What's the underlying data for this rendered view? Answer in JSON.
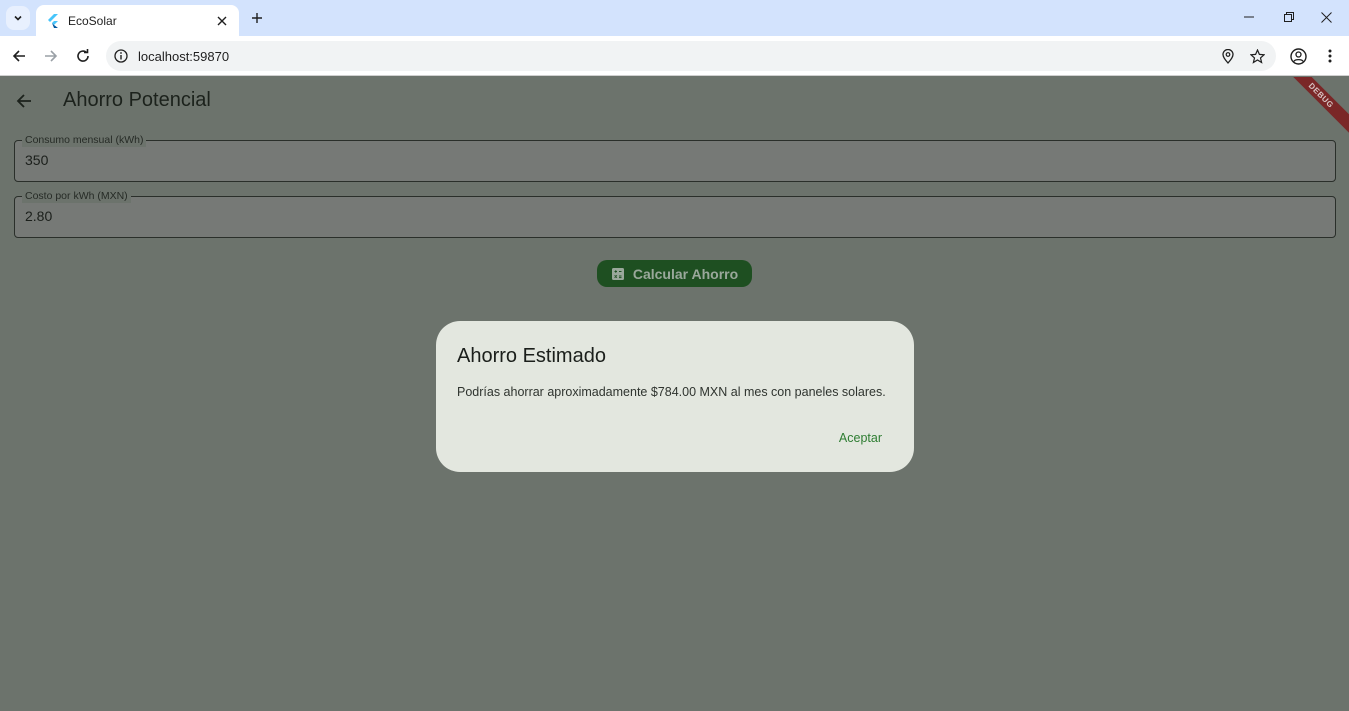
{
  "browser": {
    "tab_title": "EcoSolar",
    "url": "localhost:59870"
  },
  "app": {
    "title": "Ahorro Potencial",
    "debug_banner": "DEBUG",
    "fields": [
      {
        "label": "Consumo mensual (kWh)",
        "value": "350"
      },
      {
        "label": "Costo por kWh (MXN)",
        "value": "2.80"
      }
    ],
    "calculate_button": "Calcular Ahorro"
  },
  "dialog": {
    "title": "Ahorro Estimado",
    "message": "Podrías ahorrar aproximadamente $784.00 MXN al mes con paneles solares.",
    "action": "Aceptar"
  },
  "colors": {
    "accent": "#2e7d32",
    "button": "#1e4f21",
    "dialog_bg": "#e3e7df",
    "scrim": "#6c736c"
  }
}
